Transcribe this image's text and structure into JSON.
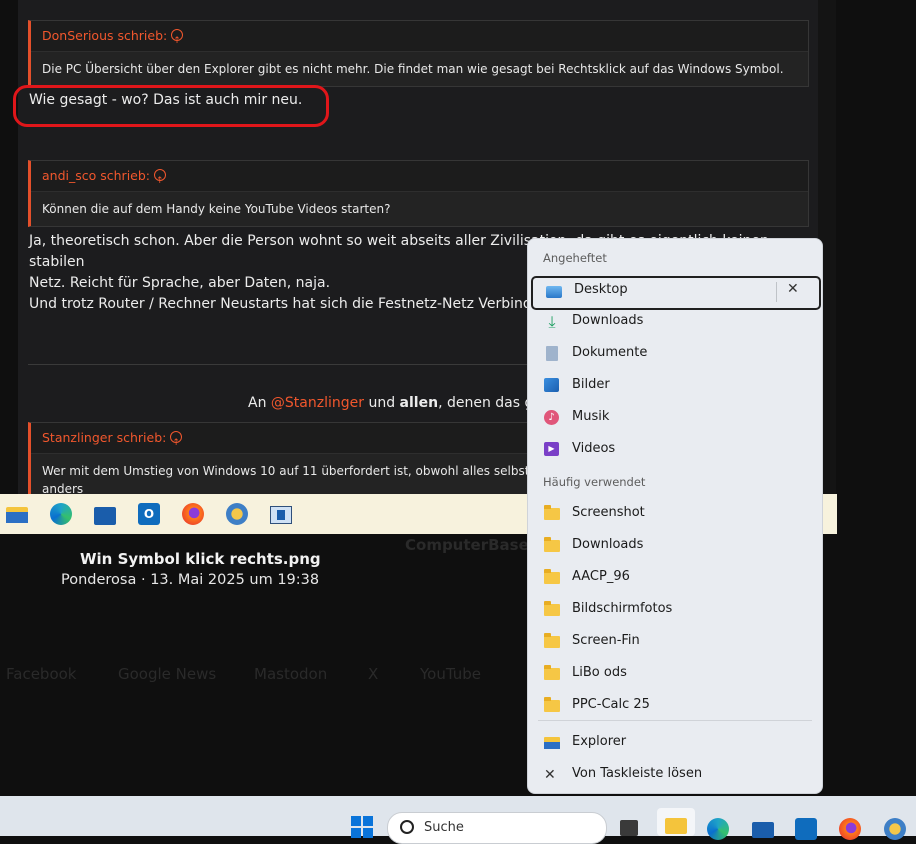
{
  "forum": {
    "quote1": {
      "author": "DonSerious schrieb:",
      "text": "Die PC Übersicht über den Explorer gibt es nicht mehr. Die findet man wie gesagt bei Rechtsklick auf das Windows Symbol."
    },
    "reply1": "Wie gesagt - wo? Das ist auch mir neu.",
    "quote2": {
      "author": "andi_sco schrieb:",
      "text": "Können die auf dem Handy keine YouTube Videos starten?"
    },
    "reply2": {
      "line1": "Ja, theoretisch schon. Aber die Person wohnt so weit abseits aller Zivilisation, da gibt es eigentlich keinen stabilen",
      "line2": "Netz. Reicht für Sprache, aber Daten, naja.",
      "line3": "Und trotz Router / Rechner Neustarts hat sich die Festnetz-Netz Verbindung nicht verbessert."
    },
    "thanks": {
      "prefix": "An ",
      "mention": "@Stanzlinger",
      "mid": " und ",
      "bold": "allen",
      "suffix": ", denen das gefällt"
    },
    "quote3": {
      "author": "Stanzlinger schrieb:",
      "text": "Wer mit dem Umstieg von Windows 10 auf 11 überfordert ist, obwohl alles selbsterklärend ist, sollte die Finger lassen! Da ist anders"
    }
  },
  "caption": {
    "title": "Win Symbol klick rechts.png",
    "subtitle": "Ponderosa · 13. Mai 2025 um 19:38"
  },
  "footer_faded": {
    "facebook": "Facebook",
    "gnews": "Google News",
    "mastodon": "Mastodon",
    "x": "X",
    "youtube": "YouTube",
    "computerbase": "ComputerBase"
  },
  "jumplist": {
    "pinned_header": "Angeheftet",
    "pinned": [
      {
        "label": "Desktop",
        "icon": "desktop-icon"
      },
      {
        "label": "Downloads",
        "icon": "download-icon"
      },
      {
        "label": "Dokumente",
        "icon": "document-icon"
      },
      {
        "label": "Bilder",
        "icon": "pictures-icon"
      },
      {
        "label": "Musik",
        "icon": "music-icon"
      },
      {
        "label": "Videos",
        "icon": "videos-icon"
      }
    ],
    "frequent_header": "Häufig verwendet",
    "frequent": [
      {
        "label": "Screenshot"
      },
      {
        "label": "Downloads"
      },
      {
        "label": "AACP_96"
      },
      {
        "label": "Bildschirmfotos"
      },
      {
        "label": "Screen-Fin"
      },
      {
        "label": "LiBo ods"
      },
      {
        "label": "PPC-Calc 25"
      }
    ],
    "actions": [
      {
        "label": "Explorer",
        "icon": "explorer-icon"
      },
      {
        "label": "Von Taskleiste lösen",
        "icon": "unpin-icon"
      }
    ]
  },
  "taskbar": {
    "search_placeholder": "Suche"
  }
}
